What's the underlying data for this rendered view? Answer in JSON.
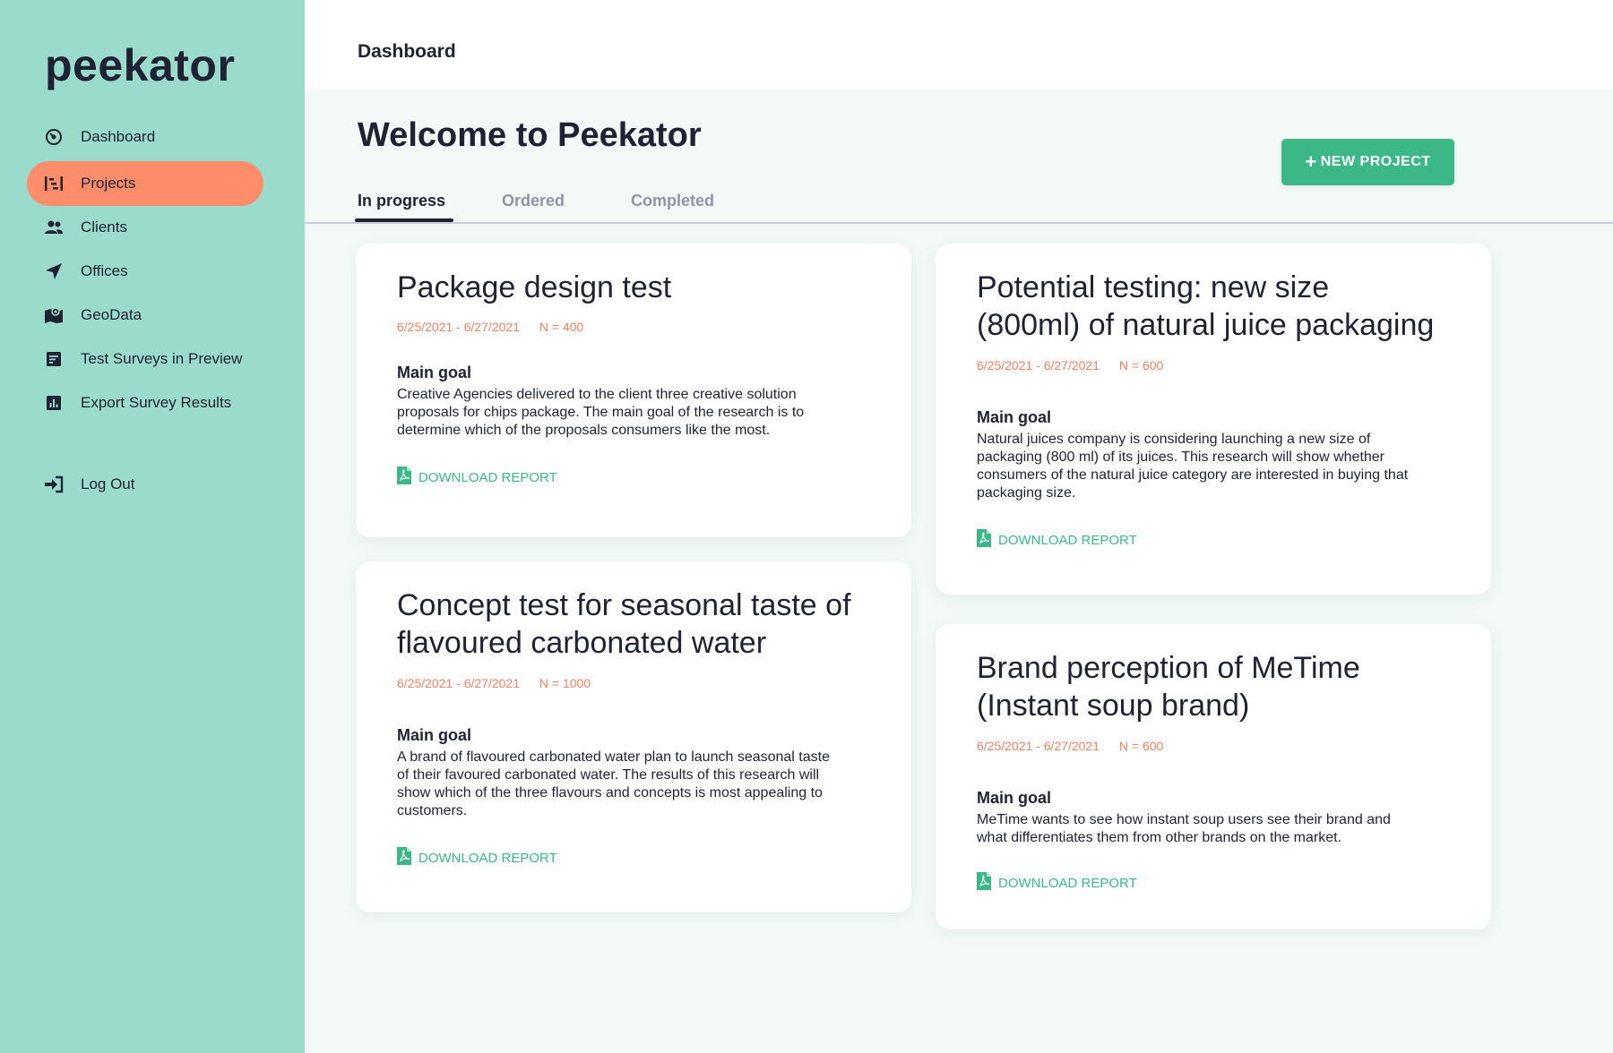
{
  "app": {
    "logo": "peekator"
  },
  "sidebar": {
    "items": [
      {
        "label": "Dashboard",
        "icon": "dashboard-icon",
        "active": false
      },
      {
        "label": "Projects",
        "icon": "projects-icon",
        "active": true
      },
      {
        "label": "Clients",
        "icon": "clients-icon",
        "active": false
      },
      {
        "label": "Offices",
        "icon": "location-arrow-icon",
        "active": false
      },
      {
        "label": "GeoData",
        "icon": "map-icon",
        "active": false
      },
      {
        "label": "Test Surveys in Preview",
        "icon": "survey-icon",
        "active": false
      },
      {
        "label": "Export  Survey Results",
        "icon": "chart-icon",
        "active": false
      },
      {
        "label": "Log Out",
        "icon": "logout-icon",
        "active": false
      }
    ]
  },
  "header": {
    "title": "Dashboard"
  },
  "main": {
    "welcome": "Welcome to Peekator",
    "new_project_label": "NEW PROJECT",
    "tabs": [
      {
        "label": "In progress",
        "active": true
      },
      {
        "label": "Ordered",
        "active": false
      },
      {
        "label": "Completed",
        "active": false
      }
    ],
    "cards": [
      {
        "title_lines": [
          "Package design test"
        ],
        "dates": "6/25/2021 - 6/27/2021",
        "n": "N = 400",
        "goal_label": "Main goal",
        "goal_lines": [
          "Creative Agencies delivered to the client three creative solution",
          "proposals for chips package. The main goal of the research is to",
          "determine which of the proposals consumers like the most."
        ],
        "download_label": "DOWNLOAD REPORT"
      },
      {
        "title_lines": [
          "Potential testing: new size",
          "(800ml) of natural juice packaging"
        ],
        "dates": "6/25/2021 - 6/27/2021",
        "n": "N = 600",
        "goal_label": "Main goal",
        "goal_lines": [
          "Natural juices company is considering launching a new size of",
          "packaging (800 ml) of its juices. This research will show whether",
          "consumers of the natural juice category are interested in buying that",
          "packaging size."
        ],
        "download_label": "DOWNLOAD REPORT"
      },
      {
        "title_lines": [
          "Concept test for seasonal taste of",
          "flavoured carbonated water"
        ],
        "dates": "6/25/2021 - 6/27/2021",
        "n": "N = 1000",
        "goal_label": "Main goal",
        "goal_lines": [
          "A brand of flavoured carbonated water plan to launch seasonal taste",
          "of their favoured carbonated water. The results of this research will",
          "show which of the three flavours and concepts is most appealing to",
          "customers."
        ],
        "download_label": "DOWNLOAD REPORT"
      },
      {
        "title_lines": [
          "Brand perception of MeTime",
          "(Instant soup brand)"
        ],
        "dates": "6/25/2021 - 6/27/2021",
        "n": "N = 600",
        "goal_label": "Main goal",
        "goal_lines": [
          "MeTime wants to see how instant soup users see their brand and",
          "what differentiates them from other brands on the market."
        ],
        "download_label": "DOWNLOAD REPORT"
      }
    ]
  },
  "colors": {
    "sidebar_bg": "#9bdbcc",
    "active_nav": "#ff8c6a",
    "accent_green": "#3cb888",
    "meta_orange": "#f08464",
    "page_bg": "#f2f9f7"
  }
}
